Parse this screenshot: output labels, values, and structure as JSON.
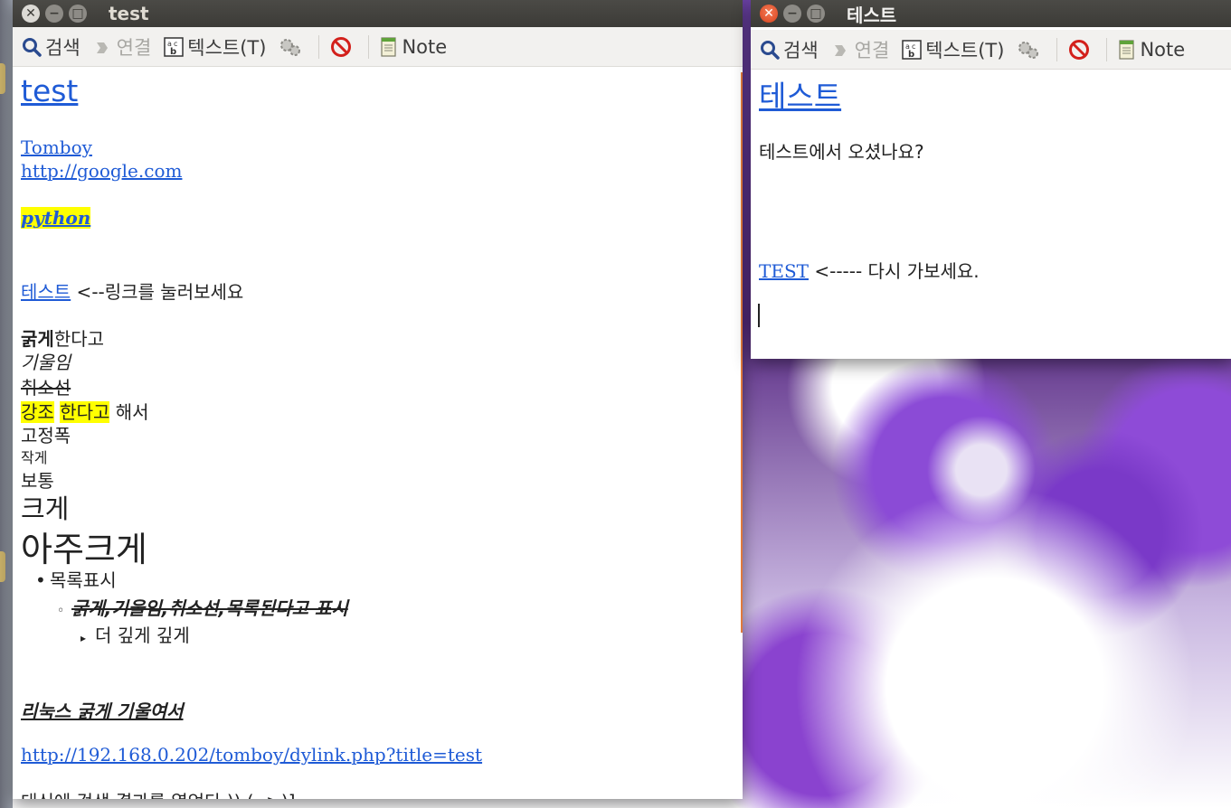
{
  "toolbar": {
    "search": "검색",
    "link": "연결",
    "text": "텍스트(T)",
    "note": "Note"
  },
  "window_left": {
    "title": "test",
    "note_title": "test",
    "links": {
      "tomboy": "Tomboy",
      "google": "http://google.com",
      "python": "python",
      "korean_link": "테스트",
      "dylink": "http://192.168.0.202/tomboy/dylink.php?title=test"
    },
    "lines": {
      "click_hint": " <--링크를 눌러보세요",
      "bold_word": "굵게",
      "bold_rest": "한다고",
      "italic": "기울임",
      "strike": "취소선",
      "emph1": "강조",
      "emph2": "한다고",
      "emph_rest": " 해서",
      "mono": "고정폭",
      "small": "작게",
      "normal": "보통",
      "large": "크게",
      "huge": "아주크게",
      "list1": "목록표시",
      "list2": "굵게,기울임,취소선,목록된다고 표시",
      "list3": "더 깊게 깊게",
      "styled": "리눅스 굵게 기울여서",
      "cutoff": "대신에 검색 결과를 열었다 )) ( ->)]"
    }
  },
  "window_right": {
    "title": "테스트",
    "note_title": "테스트",
    "question": "테스트에서 오셨나요?",
    "test_link": "TEST",
    "back_text": " <----- 다시 가보세요."
  }
}
